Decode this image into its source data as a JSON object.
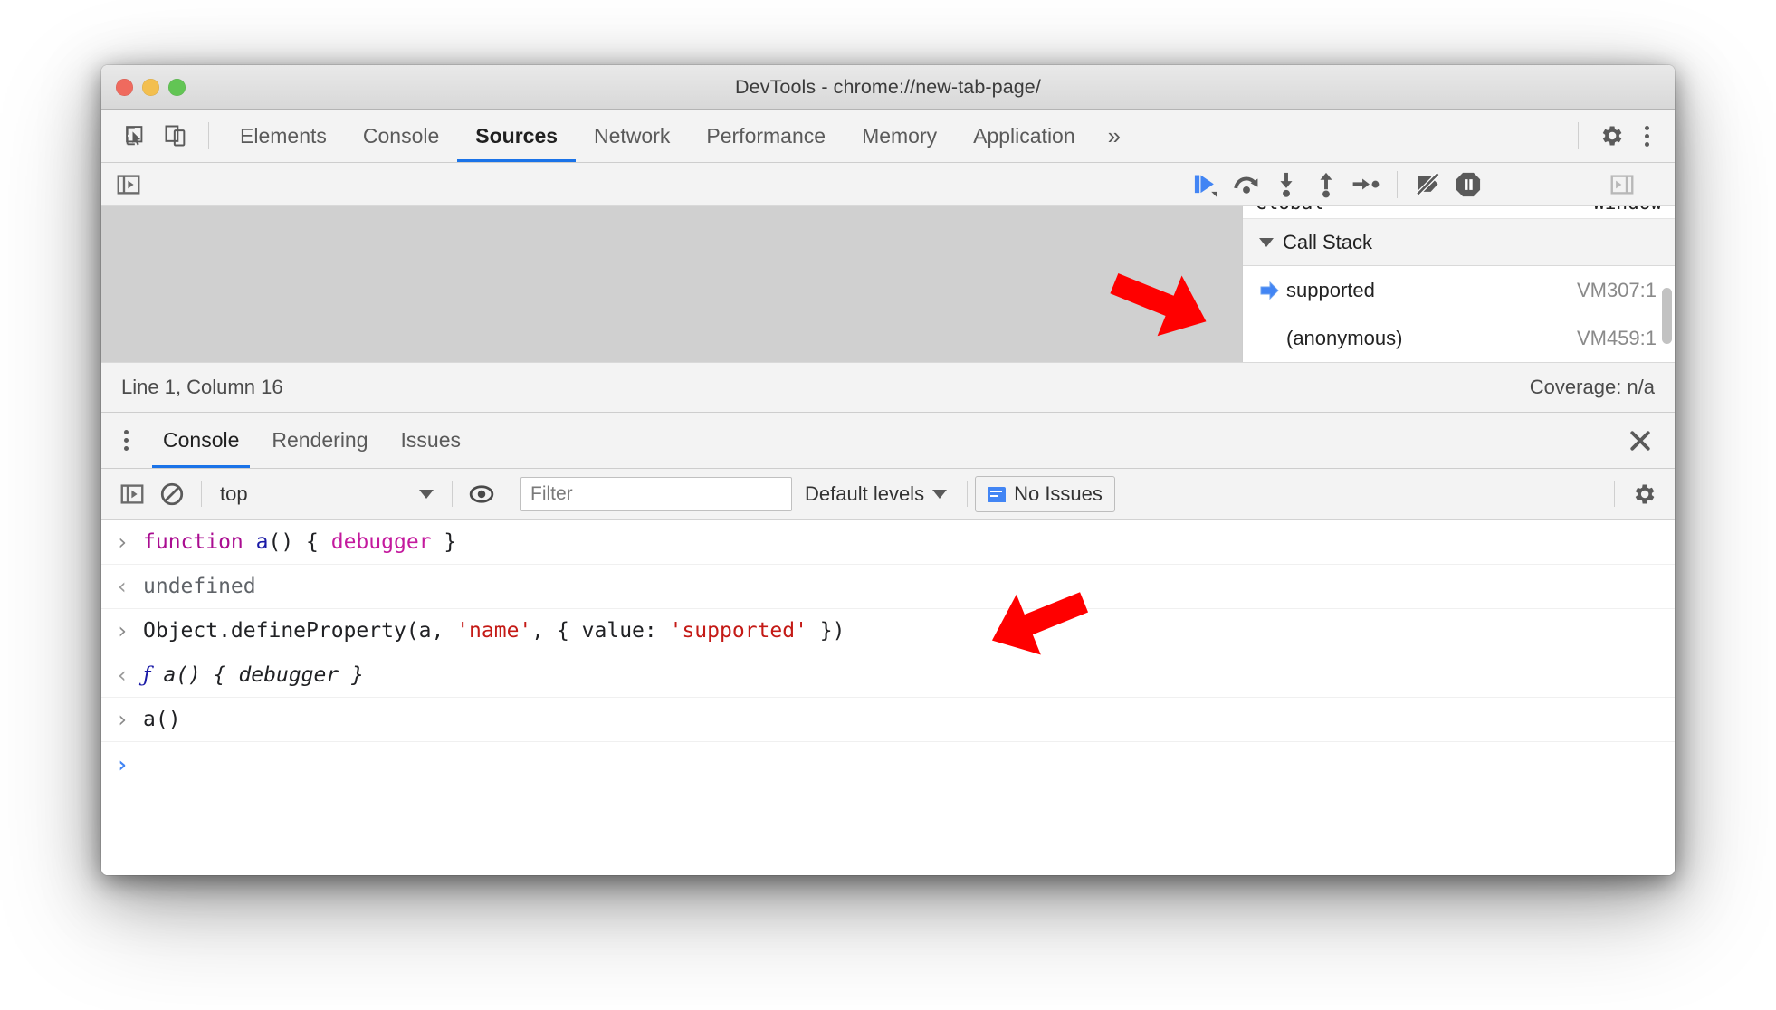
{
  "window": {
    "title": "DevTools - chrome://new-tab-page/",
    "traffic": {
      "close": "close-window",
      "minimize": "minimize-window",
      "zoom": "zoom-window"
    }
  },
  "main_tabs": {
    "inspect_icon": "inspect-element-icon",
    "device_icon": "device-toolbar-icon",
    "items": [
      {
        "label": "Elements",
        "active": false
      },
      {
        "label": "Console",
        "active": false
      },
      {
        "label": "Sources",
        "active": true
      },
      {
        "label": "Network",
        "active": false
      },
      {
        "label": "Performance",
        "active": false
      },
      {
        "label": "Memory",
        "active": false
      },
      {
        "label": "Application",
        "active": false
      }
    ],
    "more_label": "»",
    "settings_icon": "gear-icon",
    "kebab_icon": "more-options-icon"
  },
  "sources": {
    "navigator_toggle_icon": "show-navigator-icon",
    "debugger_toggle_icon": "show-debugger-icon",
    "debug_controls": [
      {
        "name": "resume-script-execution",
        "label": "Resume"
      },
      {
        "name": "step-over-next-function-call",
        "label": "Step over"
      },
      {
        "name": "step-into-next-function-call",
        "label": "Step into"
      },
      {
        "name": "step-out-of-current-function",
        "label": "Step out"
      },
      {
        "name": "step",
        "label": "Step"
      },
      {
        "name": "deactivate-breakpoints",
        "label": "Deactivate breakpoints"
      },
      {
        "name": "pause-on-exceptions",
        "label": "Pause on exceptions"
      }
    ],
    "status": {
      "position": "Line 1, Column 16",
      "coverage": "Coverage: n/a"
    }
  },
  "debugger_sidebar": {
    "clipped_scope_row": {
      "name": "Global",
      "value": "Window"
    },
    "call_stack": {
      "header": "Call Stack",
      "frames": [
        {
          "name": "supported",
          "location": "VM307:1",
          "selected": true
        },
        {
          "name": "(anonymous)",
          "location": "VM459:1",
          "selected": false
        }
      ]
    }
  },
  "drawer": {
    "kebab_icon": "drawer-more-options-icon",
    "tabs": [
      {
        "label": "Console",
        "active": true
      },
      {
        "label": "Rendering",
        "active": false
      },
      {
        "label": "Issues",
        "active": false
      }
    ],
    "close_icon": "close-drawer-icon"
  },
  "console_toolbar": {
    "sidebar_toggle_icon": "console-sidebar-icon",
    "clear_icon": "clear-console-icon",
    "context": "top",
    "eye_icon": "live-expression-icon",
    "filter_placeholder": "Filter",
    "filter_value": "",
    "levels": "Default levels",
    "issues_label": "No Issues",
    "issues_icon": "issues-icon",
    "settings_icon": "console-settings-icon"
  },
  "console_log": {
    "rows": [
      {
        "gutter": "›",
        "gutter_kind": "input",
        "tokens": [
          {
            "t": "function ",
            "c": "kw"
          },
          {
            "t": "a",
            "c": "idb"
          },
          {
            "t": "() { ",
            "c": "plain"
          },
          {
            "t": "debugger",
            "c": "kw2"
          },
          {
            "t": " }",
            "c": "plain"
          }
        ]
      },
      {
        "gutter": "‹",
        "gutter_kind": "output",
        "tokens": [
          {
            "t": "undefined",
            "c": "undef"
          }
        ]
      },
      {
        "gutter": "›",
        "gutter_kind": "input",
        "tokens": [
          {
            "t": "Object.defineProperty(a, ",
            "c": "plain"
          },
          {
            "t": "'name'",
            "c": "str"
          },
          {
            "t": ", { value: ",
            "c": "plain"
          },
          {
            "t": "'supported'",
            "c": "str"
          },
          {
            "t": " })",
            "c": "plain"
          }
        ]
      },
      {
        "gutter": "‹",
        "gutter_kind": "output",
        "tokens": [
          {
            "t": "ƒ",
            "c": "resf"
          },
          {
            "t": " a() { debugger }",
            "c": "resi"
          }
        ]
      },
      {
        "gutter": "›",
        "gutter_kind": "input",
        "tokens": [
          {
            "t": "a()",
            "c": "plain"
          }
        ]
      },
      {
        "gutter": "›",
        "gutter_kind": "prompt",
        "tokens": []
      }
    ]
  },
  "annotations": [
    {
      "name": "callout-arrow-call-stack",
      "points_to": "supported call stack frame"
    },
    {
      "name": "callout-arrow-define-property",
      "points_to": "Object.defineProperty console input"
    }
  ],
  "colors": {
    "accent_blue": "#1a73e8",
    "callout_red": "#ff0000",
    "string_red": "#c41a16",
    "keyword_purple": "#aa0d91"
  }
}
